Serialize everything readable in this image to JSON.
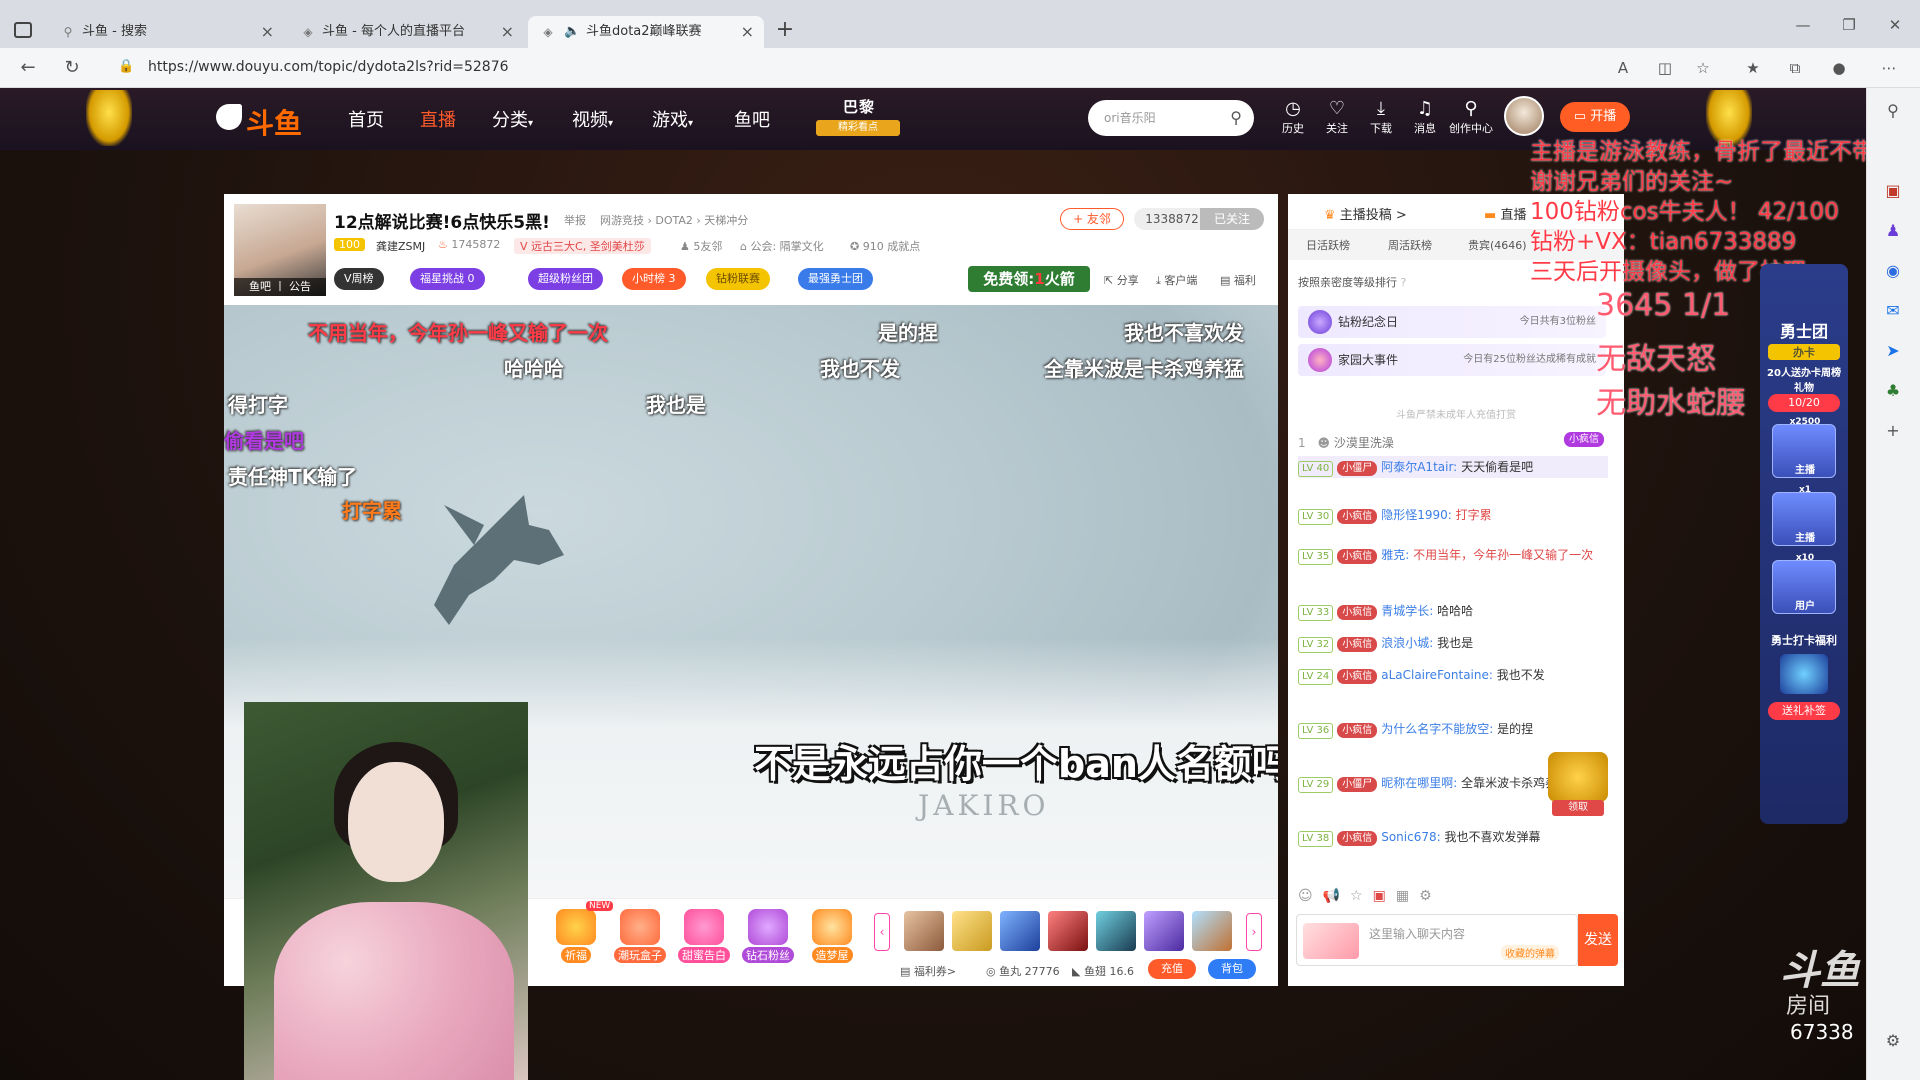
{
  "browser": {
    "tabs": [
      {
        "title": "斗鱼 - 搜索"
      },
      {
        "title": "斗鱼 - 每个人的直播平台"
      },
      {
        "title": "斗鱼dota2巅峰联赛"
      }
    ],
    "url": "https://www.douyu.com/topic/dydota2ls?rid=52876"
  },
  "nav": {
    "logo": "斗鱼",
    "items": [
      "首页",
      "直播",
      "分类",
      "视频",
      "游戏",
      "鱼吧"
    ],
    "major_title": "巴黎MAJOR",
    "major_sub": "精彩看点",
    "search_placeholder": "ori音乐阳",
    "icons": [
      {
        "label": "历史",
        "icon": "history-icon"
      },
      {
        "label": "关注",
        "icon": "heart-icon"
      },
      {
        "label": "下载",
        "icon": "download-icon"
      },
      {
        "label": "消息",
        "icon": "bell-icon"
      },
      {
        "label": "创作中心",
        "icon": "bulb-icon"
      }
    ],
    "kaibo": "开播"
  },
  "overlay": {
    "lines": [
      "主播是游泳教练，骨折了最近不带课",
      "谢谢兄弟们的关注~",
      "100钻粉cos牛夫人！ 42/100",
      "钻粉+VX：tian6733889",
      "三天后开摄像头，做了护理"
    ],
    "counter": "3645  1/1",
    "big": [
      "无敌天怒",
      "无助水蛇腰"
    ]
  },
  "room": {
    "title": "12点解说比赛!6点快乐5黑!",
    "report": "举报",
    "crumbs": "网游竞技 › DOTA2 › 天梯冲分",
    "level_badge": "100",
    "anchor": "龚建ZSMJ",
    "heat": "1745872",
    "honor": "远古三大C, 圣剑美杜莎",
    "friends": "5友邻",
    "guild": "公会: 隔掌文化",
    "achievements": "910 成就点",
    "avatar_caption": "鱼吧 丨 公告",
    "friend_btn": "+ 友邻",
    "follow_count": "1338872",
    "follow_btn": "已关注",
    "badges": [
      {
        "text": "V周榜",
        "color": "#333333"
      },
      {
        "text": "福星挑战 0",
        "color": "#7b3fe4"
      },
      {
        "text": "超级粉丝团",
        "color": "#7b3fe4"
      },
      {
        "text": "小时榜 3",
        "color": "#ff5a2a"
      },
      {
        "text": "钻粉联赛",
        "color": "#f5c400"
      },
      {
        "text": "最强勇士团",
        "color": "#3a7bea"
      }
    ],
    "free_btn_pre": "免费领:",
    "free_btn_num": "1",
    "free_btn_post": "火箭",
    "actions": [
      "分享",
      "客户端",
      "福利"
    ]
  },
  "video": {
    "danmaku": [
      "不用当年，今年孙一峰又输了一次",
      "是的捏",
      "我也不喜欢发",
      "哈哈哈",
      "我也不发",
      "全靠米波是卡杀鸡养猛",
      "得打字",
      "我也是",
      "偷看是吧",
      "责任神TK输了",
      "打字累"
    ],
    "subtitle": "不是永远占你一个ban人名额吗?",
    "hero_name": "JAKIRO"
  },
  "gifts": {
    "items": [
      {
        "label": "祈福",
        "color": "#ff8a1f"
      },
      {
        "label": "潮玩盒子",
        "color": "#ff6a3d"
      },
      {
        "label": "甜蜜告白",
        "color": "#ff4f9a"
      },
      {
        "label": "钻石粉丝",
        "color": "#b04ad8"
      },
      {
        "label": "造梦屋",
        "color": "#ff8a1f"
      }
    ],
    "new_tag": "NEW",
    "wallet": {
      "welfare": "福利券>",
      "fish_ball": "鱼丸 27776",
      "fish_fin": "鱼翅 16.6"
    },
    "charge": "充值",
    "bag": "背包"
  },
  "chat": {
    "top_tabs": [
      "主播投稿 >",
      "直播"
    ],
    "tabs": [
      "日活跃榜",
      "周活跃榜",
      "贵宾(4646)"
    ],
    "rank_hint": "按照亲密度等级排行",
    "notices": [
      {
        "title": "钻粉纪念日",
        "right": "今日共有3位粉丝"
      },
      {
        "title": "家园大事件",
        "right": "今日有25位粉丝达成稀有成就"
      }
    ],
    "warn": "斗鱼严禁未成年人充值打赏",
    "rank1": {
      "rank": "1",
      "name": "沙漠里洗澡",
      "tag": "小疯信"
    },
    "messages": [
      {
        "lv": "LV 40",
        "fan": "小僵尸",
        "nick": "阿泰尔A1tair:",
        "text": "天天偷看是吧",
        "hl": true
      },
      {
        "lv": "LV 30",
        "fan": "小疯信",
        "nick": "隐形怪1990:",
        "text": "打字累",
        "hl": false
      },
      {
        "lv": "LV 35",
        "fan": "小疯信",
        "nick": "雅克:",
        "text": "不用当年，今年孙一峰又输了一次",
        "hl": false
      },
      {
        "lv": "LV 33",
        "fan": "小疯信",
        "nick": "青城学长:",
        "text": "哈哈哈",
        "hl": false
      },
      {
        "lv": "LV 32",
        "fan": "小疯信",
        "nick": "浪浪小城:",
        "text": "我也是",
        "hl": false
      },
      {
        "lv": "LV 24",
        "fan": "小疯信",
        "nick": "aLaClaireFontaine:",
        "text": "我也不发",
        "hl": false
      },
      {
        "lv": "LV 36",
        "fan": "小疯信",
        "nick": "为什么名字不能放空:",
        "text": "是的捏",
        "hl": false
      },
      {
        "lv": "LV 29",
        "fan": "小僵尸",
        "nick": "昵称在哪里啊:",
        "text": "全靠米波卡杀鸡养猛",
        "hl": false
      },
      {
        "lv": "LV 38",
        "fan": "小疯信",
        "nick": "Sonic678:",
        "text": "我也不喜欢发弹幕",
        "hl": false
      }
    ],
    "treasure_label": "领取",
    "input_placeholder": "这里输入聊天内容",
    "input_tag": "收藏的弹幕",
    "send": "发送"
  },
  "widget": {
    "title": "勇士团",
    "card1_title": "办卡",
    "card1_sub": "20人送办卡周榜礼物",
    "progress": "10/20",
    "cards": [
      {
        "count": "x2500",
        "label": "主播"
      },
      {
        "count": "x1",
        "label": "主播"
      },
      {
        "count": "x10",
        "label": "用户"
      }
    ],
    "bottom_title": "勇士打卡福利",
    "bottom_btn": "送礼补签"
  },
  "watermark": {
    "logo": "斗鱼",
    "sub": "房间",
    "room": "67338"
  }
}
